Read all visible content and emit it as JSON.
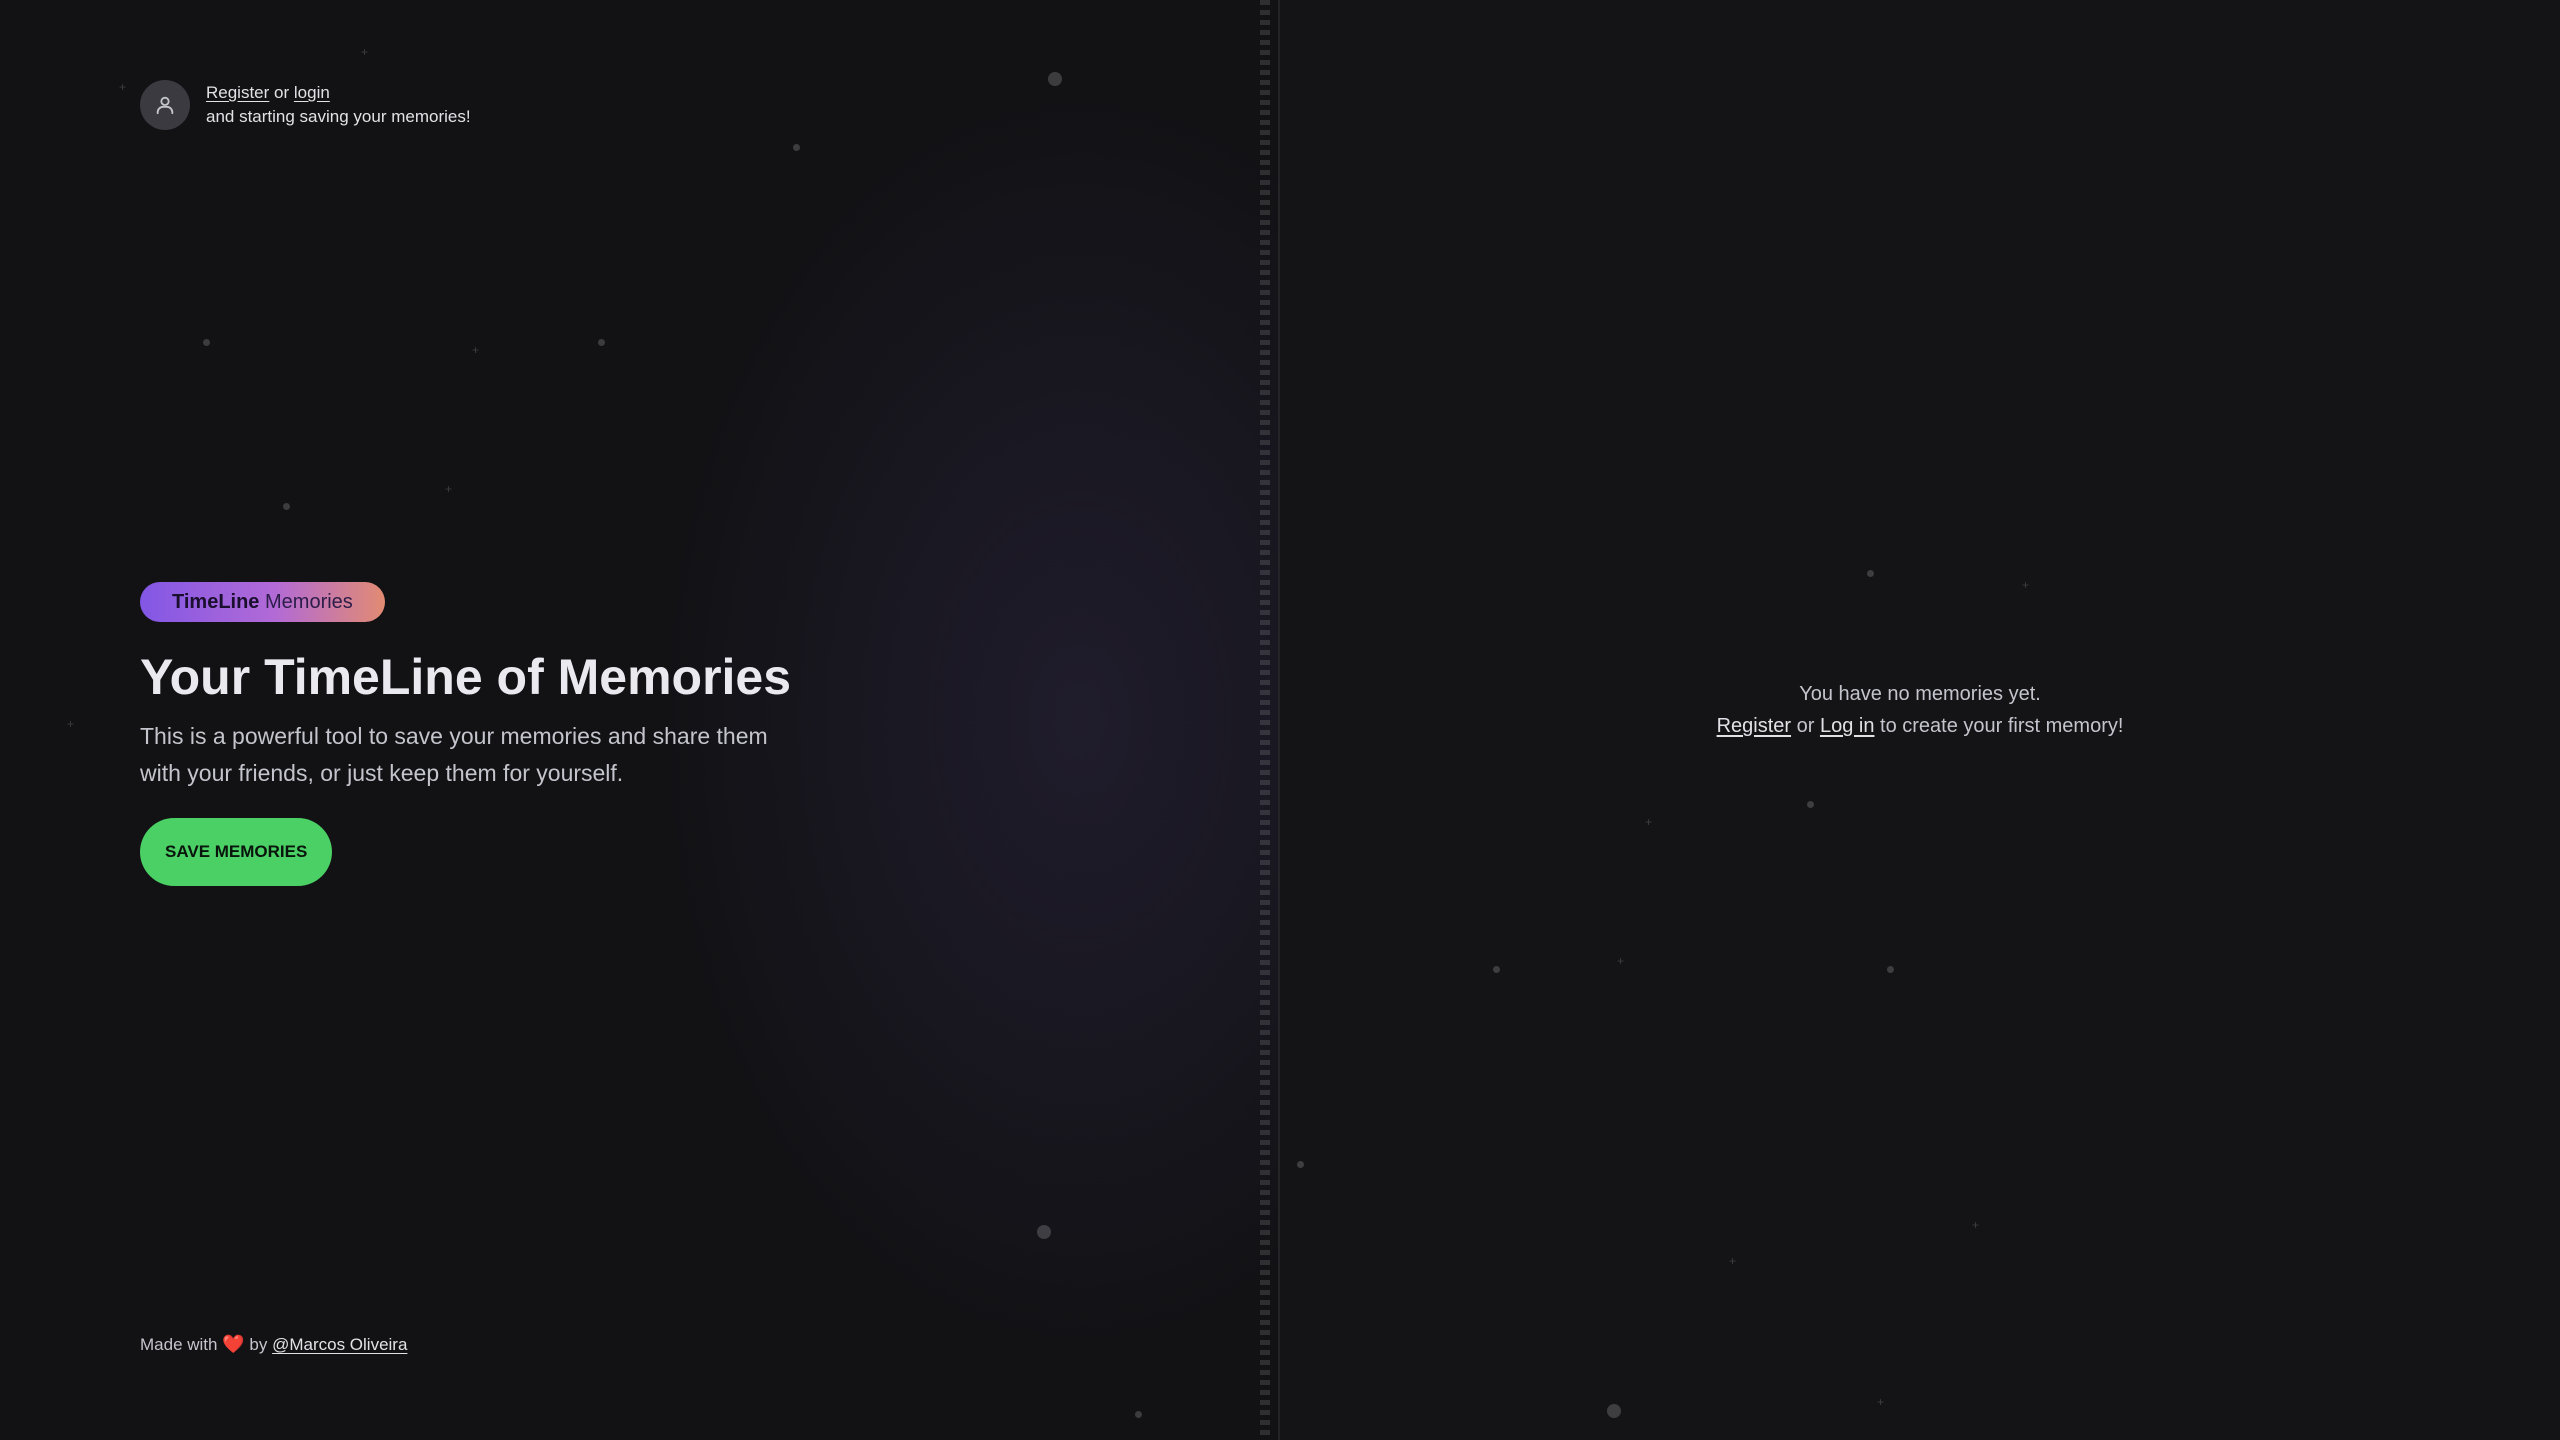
{
  "auth_prompt": {
    "register_label": "Register",
    "or_label": "or",
    "login_label": "login",
    "subtitle": "and starting saving your memories!",
    "icon": "user-icon"
  },
  "hero": {
    "badge_bold": "TimeLine",
    "badge_light": "Memories",
    "title": "Your TimeLine of Memories",
    "description": "This is a powerful tool to save your memories and share them with your friends, or just keep them for yourself.",
    "cta_label": "SAVE MEMORIES"
  },
  "footer": {
    "made_with": "Made with",
    "heart": "❤️",
    "by": "by",
    "author_link": "@Marcos Oliveira"
  },
  "empty_state": {
    "line1": "You have no memories yet.",
    "register_label": "Register",
    "or_label": "or",
    "login_label": "Log in",
    "suffix": "to create your first memory!"
  },
  "colors": {
    "background": "#121215",
    "accent_green": "#4ad064",
    "badge_gradient_start": "#8257e5",
    "badge_gradient_end": "#e28b72"
  }
}
